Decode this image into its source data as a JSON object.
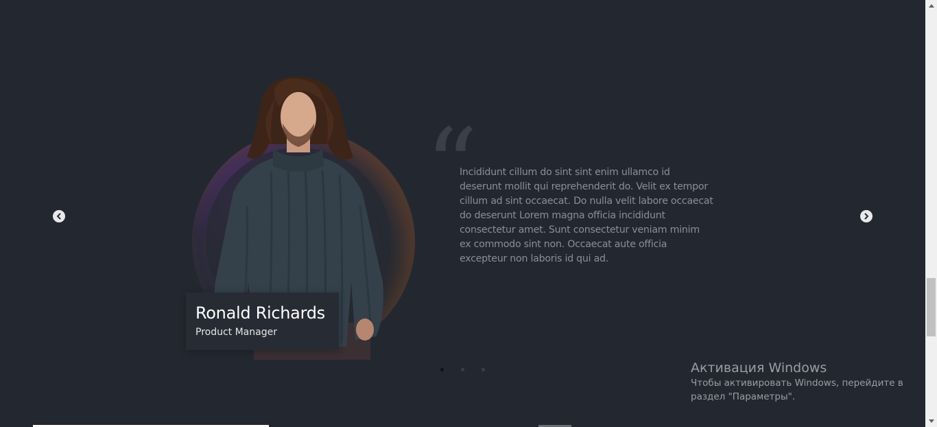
{
  "testimonial": {
    "name": "Ronald Richards",
    "role": "Product Manager",
    "quote_glyph": "“",
    "text": "Incididunt cillum do sint sint enim ullamco id deserunt mollit qui reprehenderit do. Velit ex tempor cillum ad sint occaecat. Do nulla velit labore occaecat do deserunt Lorem magna officia incididunt consectetur amet. Sunt consectetur veniam minim ex commodo sint non. Occaecat aute officia excepteur non laboris id qui ad."
  },
  "carousel": {
    "prev_icon": "chevron-left-circle-icon",
    "next_icon": "chevron-right-circle-icon",
    "slide_count": 3,
    "active_slide": 1
  },
  "windows_activation": {
    "title": "Активация Windows",
    "line1": "Чтобы активировать Windows, перейдите в",
    "line2": "раздел \"Параметры\"."
  },
  "scrollbar": {
    "position_fraction": 0.65
  },
  "colors": {
    "background": "#232830",
    "card": "#272b33",
    "text_muted": "#8a8e96",
    "accent_glow": "#4a2f6a"
  }
}
